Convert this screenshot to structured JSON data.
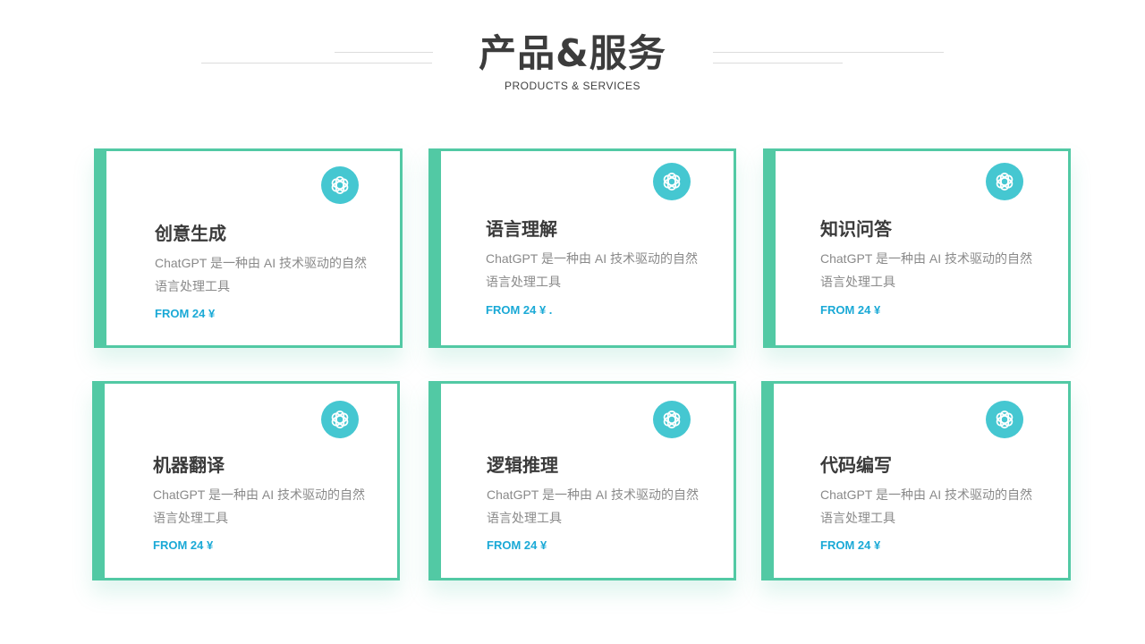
{
  "header": {
    "title": "产品&服务",
    "subtitle": "PRODUCTS & SERVICES"
  },
  "colors": {
    "accent": "#52c9a4",
    "logo": "#45c7d1",
    "price": "#1aa9d6"
  },
  "cards": [
    {
      "title": "创意生成",
      "desc": "ChatGPT 是一种由 AI 技术驱动的自然语言处理工具",
      "price": "FROM 24 ¥",
      "icon": "openai-logo-icon"
    },
    {
      "title": "语言理解",
      "desc": "ChatGPT 是一种由 AI 技术驱动的自然语言处理工具",
      "price": "FROM 24 ¥ .",
      "icon": "openai-logo-icon"
    },
    {
      "title": "知识问答",
      "desc": "ChatGPT 是一种由 AI 技术驱动的自然语言处理工具",
      "price": "FROM 24 ¥",
      "icon": "openai-logo-icon"
    },
    {
      "title": "机器翻译",
      "desc": "ChatGPT 是一种由 AI 技术驱动的自然语言处理工具",
      "price": "FROM 24 ¥",
      "icon": "openai-logo-icon"
    },
    {
      "title": "逻辑推理",
      "desc": "ChatGPT 是一种由 AI 技术驱动的自然语言处理工具",
      "price": "FROM 24 ¥",
      "icon": "openai-logo-icon"
    },
    {
      "title": "代码编写",
      "desc": "ChatGPT 是一种由 AI 技术驱动的自然语言处理工具",
      "price": "FROM 24 ¥",
      "icon": "openai-logo-icon"
    }
  ]
}
